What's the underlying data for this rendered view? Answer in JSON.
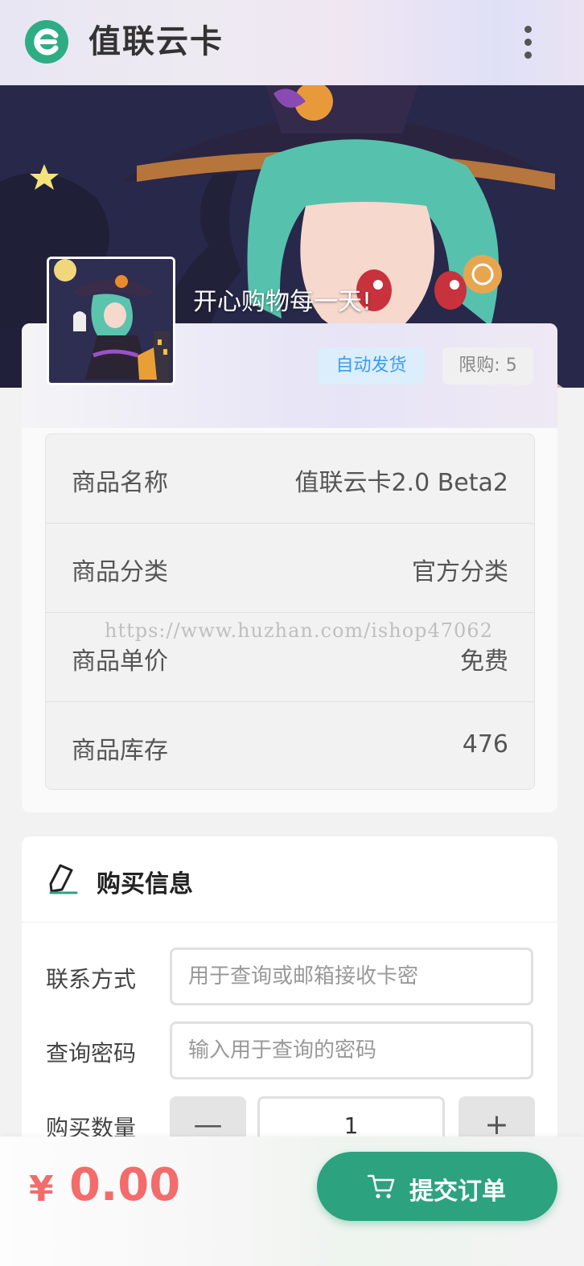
{
  "header": {
    "title": "值联云卡"
  },
  "banner": {
    "slogan": "开心购物每一天!"
  },
  "badges": {
    "auto": "自动发货",
    "limit": "限购: 5"
  },
  "product": {
    "rows": [
      {
        "label": "商品名称",
        "value": "值联云卡2.0 Beta2"
      },
      {
        "label": "商品分类",
        "value": "官方分类"
      },
      {
        "label": "商品单价",
        "value": "免费"
      },
      {
        "label": "商品库存",
        "value": "476"
      }
    ]
  },
  "watermark": "https://www.huzhan.com/ishop47062",
  "purchase": {
    "title": "购买信息",
    "contact_label": "联系方式",
    "contact_placeholder": "用于查询或邮箱接收卡密",
    "password_label": "查询密码",
    "password_placeholder": "输入用于查询的密码",
    "quantity_label": "购买数量",
    "quantity_value": "1",
    "minus": "—",
    "plus": "+"
  },
  "footer": {
    "currency": "¥",
    "price": "0.00",
    "submit": "提交订单"
  },
  "colors": {
    "accent": "#2da27f",
    "price": "#f26c6c",
    "badge_blue": "#3b9cf0"
  },
  "icons": [
    "logo-icon",
    "more-vertical-icon",
    "edit-pen-icon",
    "cart-icon"
  ]
}
